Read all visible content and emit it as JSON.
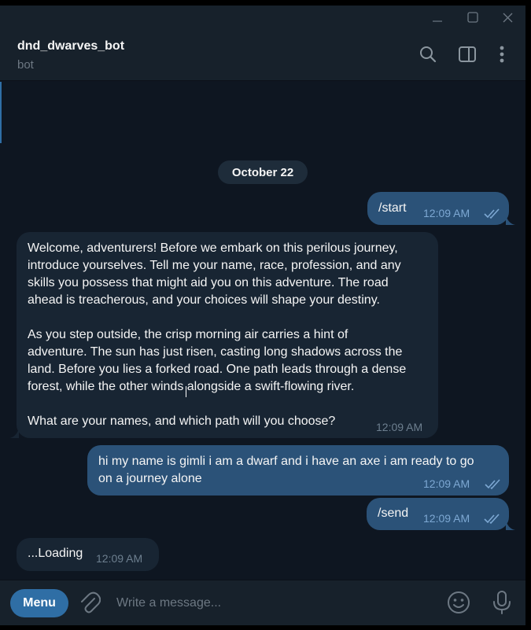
{
  "window": {
    "controls": [
      "minimize-icon",
      "maximize-icon",
      "close-icon"
    ]
  },
  "header": {
    "title": "dnd_dwarves_bot",
    "subtitle": "bot",
    "icons": [
      "search-icon",
      "sidebar-toggle-icon",
      "more-vertical-icon"
    ]
  },
  "chat": {
    "date_separator": "October 22",
    "messages": [
      {
        "direction": "outgoing",
        "text": "/start",
        "time": "12:09 AM",
        "status": "read"
      },
      {
        "direction": "incoming",
        "text": "Welcome, adventurers! Before we embark on this perilous journey,\nintroduce yourselves. Tell me your name, race, profession, and any\nskills you possess that might aid you on this adventure. The road\nahead is treacherous, and your choices will shape your destiny.\n\nAs you step outside, the crisp morning air carries a hint of\nadventure. The sun has just risen, casting long shadows across the\nland. Before you lies a forked road. One path leads through a dense\nforest, while the other winds alongside a swift-flowing river.\n\nWhat are your names, and which path will you choose?",
        "time": "12:09 AM"
      },
      {
        "direction": "outgoing",
        "text": "hi my name is gimli i am a dwarf and i have an axe i am ready to go\non a journey alone",
        "time": "12:09 AM",
        "status": "read"
      },
      {
        "direction": "outgoing",
        "text": "/send",
        "time": "12:09 AM",
        "status": "read"
      },
      {
        "direction": "incoming",
        "text": "...Loading",
        "time": "12:09 AM"
      }
    ]
  },
  "composer": {
    "menu_label": "Menu",
    "placeholder": "Write a message...",
    "icons": [
      "paperclip-icon",
      "emoji-icon",
      "microphone-icon"
    ]
  },
  "colors": {
    "background": "#0e1621",
    "header": "#17212b",
    "outgoing_bubble": "#2b5278",
    "incoming_bubble": "#182533",
    "accent": "#2f6ea5",
    "muted_text": "#6d7883",
    "read_check": "#7da8d3"
  }
}
